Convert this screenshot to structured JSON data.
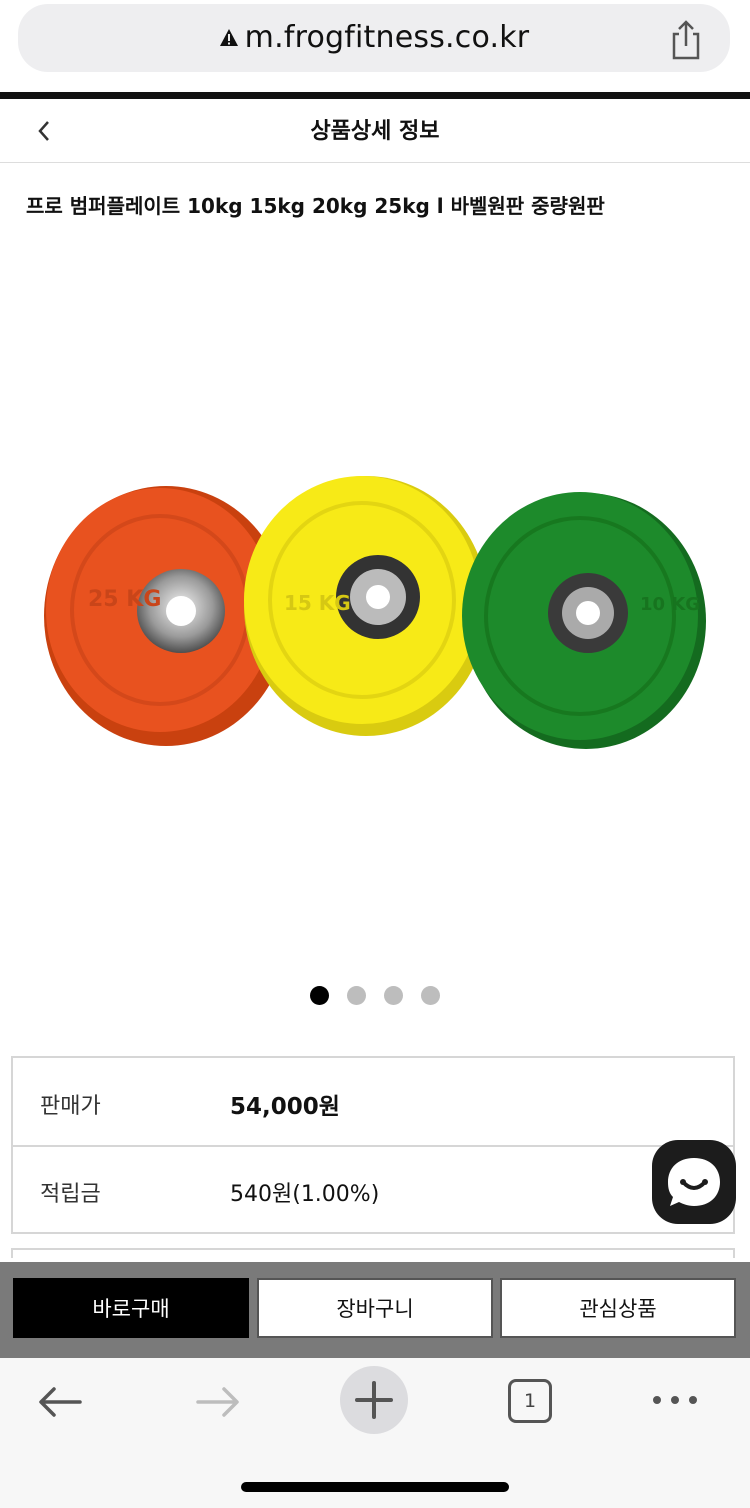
{
  "browser": {
    "url": "m.frogfitness.co.kr",
    "tab_count": "1"
  },
  "header": {
    "title": "상품상세 정보"
  },
  "product": {
    "title": "프로 범퍼플레이트 10kg 15kg 20kg 25kg l 바벨원판 중량원판",
    "plates": [
      {
        "color": "#e8521f",
        "label": "25 KG"
      },
      {
        "color": "#f7ea17",
        "label": "15 KG"
      },
      {
        "color": "#1d8a2b",
        "label": "10 KG"
      }
    ],
    "image_count": 4,
    "active_image": 1
  },
  "pricing": {
    "price_label": "판매가",
    "price_value": "54,000원",
    "points_label": "적립금",
    "points_value": "540원(1.00%)"
  },
  "actions": {
    "buy_now": "바로구매",
    "cart": "장바구니",
    "wishlist": "관심상품"
  }
}
